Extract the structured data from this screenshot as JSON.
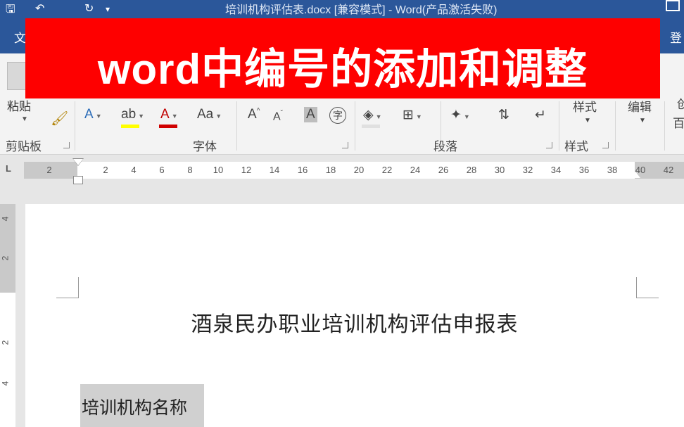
{
  "window": {
    "title": "培训机构评估表.docx [兼容模式] - Word(产品激活失败)"
  },
  "tabs": {
    "file": "文",
    "right_partial": "登"
  },
  "banner": {
    "text": "word中编号的添加和调整",
    "color": "#fe0000"
  },
  "ribbon": {
    "clipboard": {
      "paste_label": "粘贴",
      "group_label": "剪贴板"
    },
    "font": {
      "group_label": "字体",
      "tools": [
        "A",
        "ab",
        "A",
        "Aa",
        "A",
        "A",
        "A",
        "字"
      ]
    },
    "paragraph": {
      "group_label": "段落"
    },
    "styles": {
      "button_label": "样式",
      "group_label": "样式"
    },
    "editing": {
      "button_label": "编辑"
    },
    "right_partial_top": "创",
    "right_partial_bottom": "百"
  },
  "ruler": {
    "corner": "L",
    "ticks": [
      "2",
      "2",
      "4",
      "6",
      "8",
      "10",
      "12",
      "14",
      "16",
      "18",
      "20",
      "22",
      "24",
      "26",
      "28",
      "30",
      "32",
      "34",
      "36",
      "38",
      "40",
      "42"
    ],
    "vticks": [
      "4",
      "2",
      "2",
      "4"
    ]
  },
  "document": {
    "title": "酒泉民办职业培训机构评估申报表",
    "cell_label": "培训机构名称"
  }
}
